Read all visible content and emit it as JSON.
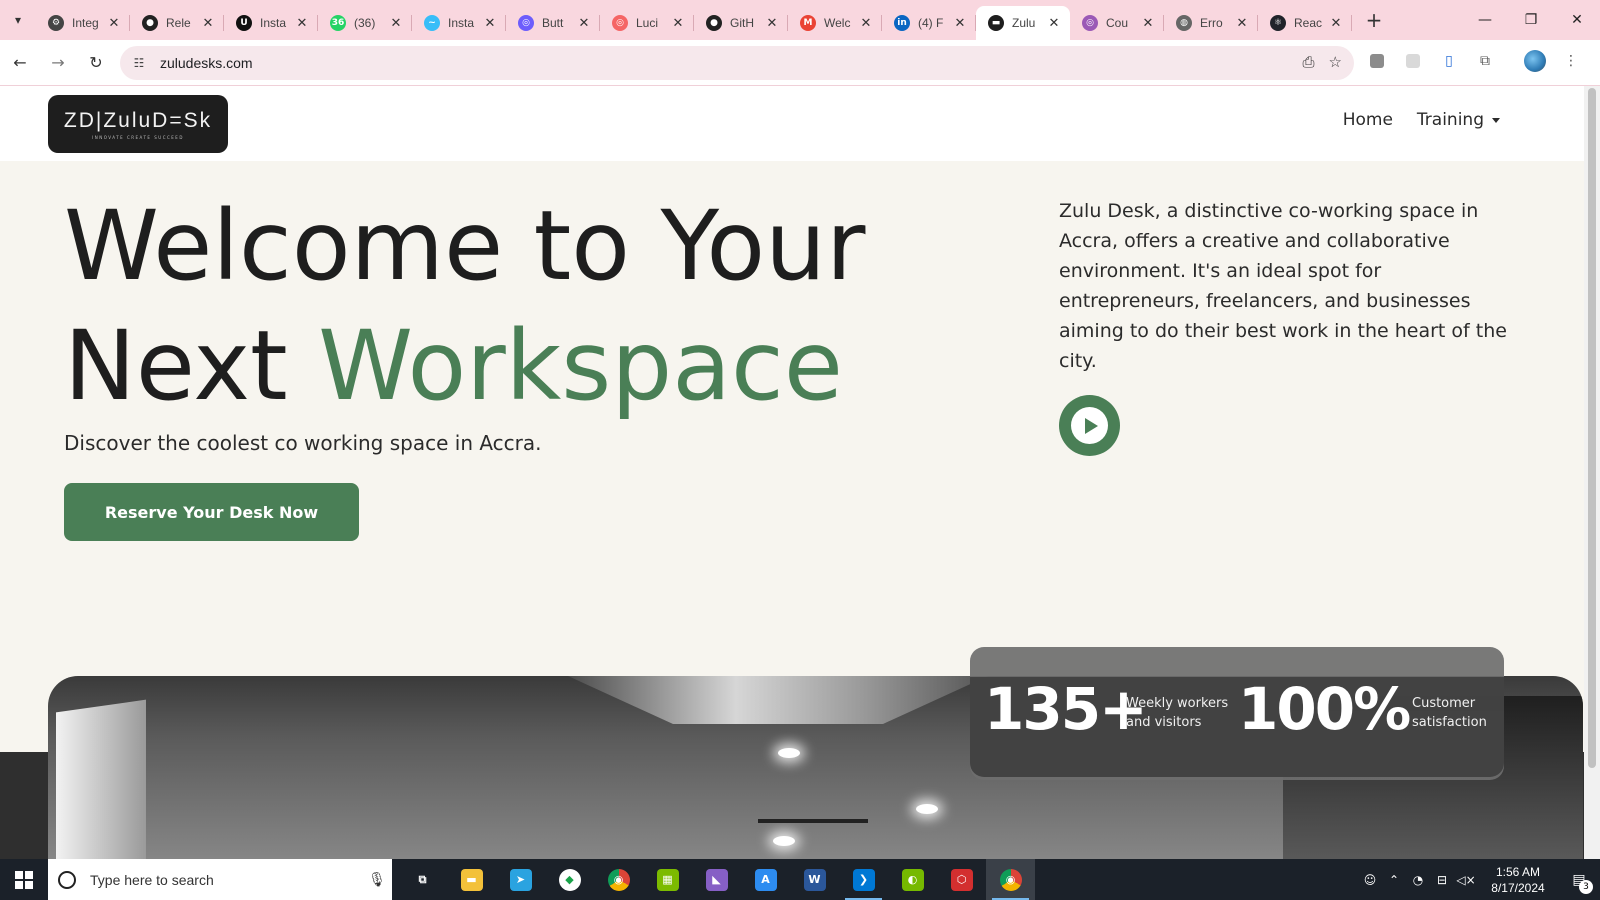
{
  "browser": {
    "tabs": [
      {
        "title": "Integ",
        "icon": "openai-icon",
        "color": "#444444",
        "glyph": "⚙"
      },
      {
        "title": "Rele",
        "icon": "github-icon",
        "color": "#222222",
        "glyph": "●"
      },
      {
        "title": "Insta",
        "icon": "upwork-icon",
        "color": "#111111",
        "glyph": "U"
      },
      {
        "title": "(36)",
        "icon": "whatsapp-icon",
        "color": "#25d366",
        "glyph": "36"
      },
      {
        "title": "Insta",
        "icon": "tailwind-icon",
        "color": "#38bdf8",
        "glyph": "~"
      },
      {
        "title": "Butt",
        "icon": "button-icon",
        "color": "#6d5dfc",
        "glyph": "◎"
      },
      {
        "title": "Luci",
        "icon": "lucide-icon",
        "color": "#f56565",
        "glyph": "◎"
      },
      {
        "title": "GitH",
        "icon": "github-icon",
        "color": "#222222",
        "glyph": "●"
      },
      {
        "title": "Welc",
        "icon": "gmail-icon",
        "color": "#ea4335",
        "glyph": "M"
      },
      {
        "title": "(4) F",
        "icon": "linkedin-icon",
        "color": "#0a66c2",
        "glyph": "in"
      },
      {
        "title": "Zulu",
        "icon": "zuludesk-icon",
        "color": "#1e1e1e",
        "glyph": "▬"
      },
      {
        "title": "Cou",
        "icon": "course-icon",
        "color": "#9b59b6",
        "glyph": "◎"
      },
      {
        "title": "Erro",
        "icon": "globe-icon",
        "color": "#666666",
        "glyph": "◍"
      },
      {
        "title": "Reac",
        "icon": "react-icon",
        "color": "#20232a",
        "glyph": "⚛"
      }
    ],
    "active_tab_index": 10,
    "url": "zuludesks.com"
  },
  "site": {
    "logo_text": "ZD|ZuluD=Sk",
    "logo_tagline": "INNOVATE CREATE SUCCEED",
    "nav": {
      "home": "Home",
      "training": "Training"
    },
    "hero": {
      "title_line1": "Welcome to Your",
      "title_line2_prefix": "Next ",
      "title_line2_accent": "Workspace",
      "subtitle": "Discover the coolest co working space in Accra.",
      "cta": "Reserve Your Desk Now"
    },
    "intro": "Zulu Desk, a distinctive co-working space in Accra, offers a creative and collaborative environment. It's an ideal spot for entrepreneurs, freelancers, and businesses aiming to do their best work in the heart of the city.",
    "stats": [
      {
        "value": "135+",
        "label_line1": "Weekly workers",
        "label_line2": "and visitors"
      },
      {
        "value": "100%",
        "label_line1": "Customer",
        "label_line2": "satisfaction"
      }
    ],
    "accent_color": "#4a7f56"
  },
  "taskbar": {
    "search_placeholder": "Type here to search",
    "time": "1:56 AM",
    "date": "8/17/2024",
    "notification_count": "3",
    "apps": [
      {
        "name": "task-view-icon",
        "color": "transparent",
        "glyph": "⧉"
      },
      {
        "name": "file-explorer-icon",
        "color": "#f3c13a",
        "glyph": "▬"
      },
      {
        "name": "telegram-icon",
        "color": "#2aa3e0",
        "glyph": "➤"
      },
      {
        "name": "mongodb-compass-icon",
        "color": "#ffffff",
        "glyph": "◆"
      },
      {
        "name": "chrome-icon",
        "color": "#db4437",
        "glyph": "◉"
      },
      {
        "name": "microsoft-store-icon",
        "color": "#7cbb00",
        "glyph": "▦"
      },
      {
        "name": "visual-studio-icon",
        "color": "#865fc5",
        "glyph": "◣"
      },
      {
        "name": "app-store-icon",
        "color": "#2d8cf0",
        "glyph": "A"
      },
      {
        "name": "word-icon",
        "color": "#2b579a",
        "glyph": "W"
      },
      {
        "name": "vscode-icon",
        "color": "#0078d4",
        "glyph": "❯"
      },
      {
        "name": "nvidia-icon",
        "color": "#76b900",
        "glyph": "◐"
      },
      {
        "name": "security-icon",
        "color": "#d32f2f",
        "glyph": "⬡"
      },
      {
        "name": "chrome-active-icon",
        "color": "#db4437",
        "glyph": "◉"
      }
    ]
  }
}
